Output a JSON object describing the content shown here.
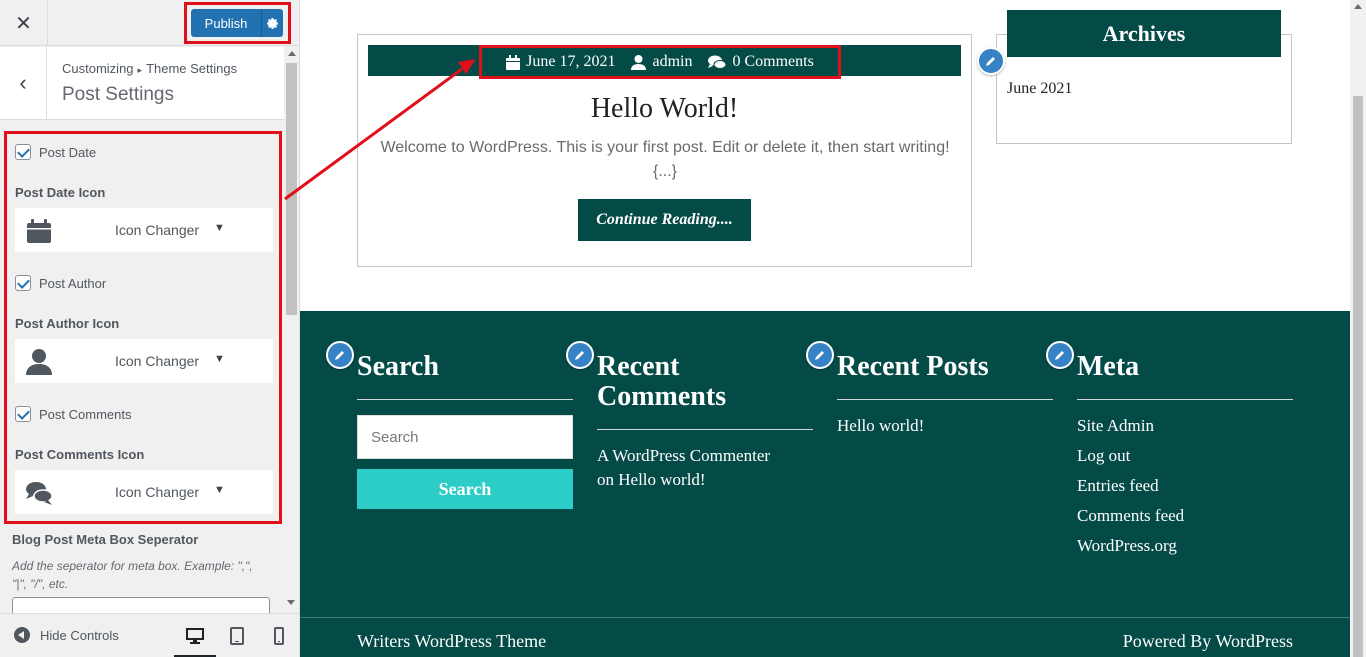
{
  "customizer": {
    "close_icon": "close-icon",
    "publish_label": "Publish",
    "breadcrumb": {
      "parent": "Customizing",
      "separator": "▸",
      "current": "Theme Settings"
    },
    "section_title": "Post Settings",
    "controls": {
      "post_date": {
        "checkbox_label": "Post Date",
        "checked": true,
        "icon_label": "Post Date Icon",
        "icon": "calendar-icon",
        "changer_label": "Icon Changer"
      },
      "post_author": {
        "checkbox_label": "Post Author",
        "checked": true,
        "icon_label": "Post Author Icon",
        "icon": "user-icon",
        "changer_label": "Icon Changer"
      },
      "post_comments": {
        "checkbox_label": "Post Comments",
        "checked": true,
        "icon_label": "Post Comments Icon",
        "icon": "comments-icon",
        "changer_label": "Icon Changer"
      }
    },
    "meta_separator": {
      "label": "Blog Post Meta Box Seperator",
      "description": "Add the seperator for meta box. Example: \",\", \"|\", \"/\", etc.",
      "value": ""
    },
    "footer": {
      "hide_controls": "Hide Controls",
      "devices": [
        "desktop-icon",
        "tablet-icon",
        "mobile-icon"
      ],
      "active_device": "desktop"
    }
  },
  "preview": {
    "post": {
      "meta": {
        "date": "June 17, 2021",
        "author": "admin",
        "comments": "0 Comments"
      },
      "title": "Hello World!",
      "excerpt": "Welcome to WordPress. This is your first post. Edit or delete it, then start writing! {...}",
      "read_more": "Continue Reading...."
    },
    "archives": {
      "title": "Archives",
      "items": [
        "June 2021"
      ]
    },
    "footer_widgets": {
      "search": {
        "title": "Search",
        "placeholder": "Search",
        "button": "Search"
      },
      "recent_comments": {
        "title": "Recent Comments",
        "title_line1": "Recent",
        "title_line2": "Comments",
        "items": [
          "A WordPress Commenter on Hello world!"
        ],
        "line1": "A WordPress Commenter",
        "line2": "on Hello world!"
      },
      "recent_posts": {
        "title": "Recent Posts",
        "items": [
          "Hello world!"
        ]
      },
      "meta": {
        "title": "Meta",
        "items": [
          "Site Admin",
          "Log out",
          "Entries feed",
          "Comments feed",
          "WordPress.org"
        ]
      }
    },
    "site_footer": {
      "left": "Writers WordPress Theme",
      "right": "Powered By WordPress"
    }
  },
  "colors": {
    "brand_dark_green": "#044b47",
    "search_button": "#2ccdc6",
    "wp_blue": "#2271b1",
    "highlight_red": "#e0101a",
    "edit_shortcut_blue": "#3582c4"
  }
}
